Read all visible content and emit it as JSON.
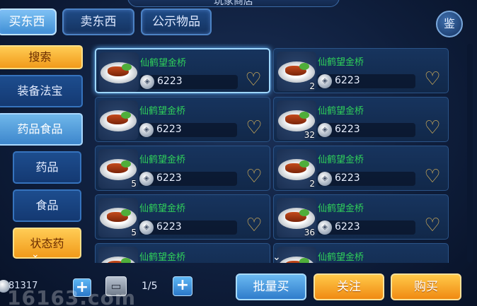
{
  "window": {
    "title": "玩家商店"
  },
  "tabs": [
    {
      "label": "买东西",
      "active": true
    },
    {
      "label": "卖东西",
      "active": false
    },
    {
      "label": "公示物品",
      "active": false
    }
  ],
  "appraise_label": "鉴",
  "menu": {
    "search_label": "搜索",
    "items": [
      {
        "label": "装备法宝"
      },
      {
        "label": "药品食品"
      },
      {
        "label": "药品"
      },
      {
        "label": "食品"
      },
      {
        "label": "状态药"
      }
    ]
  },
  "items": [
    {
      "name": "仙鹤望金桥",
      "price": "6223",
      "qty": "",
      "selected": true
    },
    {
      "name": "仙鹤望金桥",
      "price": "6223",
      "qty": "2",
      "selected": false
    },
    {
      "name": "仙鹤望金桥",
      "price": "6223",
      "qty": "",
      "selected": false
    },
    {
      "name": "仙鹤望金桥",
      "price": "6223",
      "qty": "32",
      "selected": false
    },
    {
      "name": "仙鹤望金桥",
      "price": "6223",
      "qty": "5",
      "selected": false
    },
    {
      "name": "仙鹤望金桥",
      "price": "6223",
      "qty": "2",
      "selected": false
    },
    {
      "name": "仙鹤望金桥",
      "price": "6223",
      "qty": "5",
      "selected": false
    },
    {
      "name": "仙鹤望金桥",
      "price": "6223",
      "qty": "36",
      "selected": false
    },
    {
      "name": "仙鹤望金桥",
      "price": "",
      "qty": "",
      "selected": false
    },
    {
      "name": "仙鹤望金桥",
      "price": "",
      "qty": "",
      "selected": false
    }
  ],
  "footer": {
    "money": "81317",
    "page": "1/5",
    "bulk_buy_label": "批量买",
    "follow_label": "关注",
    "buy_label": "购买"
  },
  "watermark": "16163.com",
  "colors": {
    "item_name": "#2fd05a",
    "accent_gold": "#f19a1a",
    "accent_blue": "#3f8ed4"
  }
}
